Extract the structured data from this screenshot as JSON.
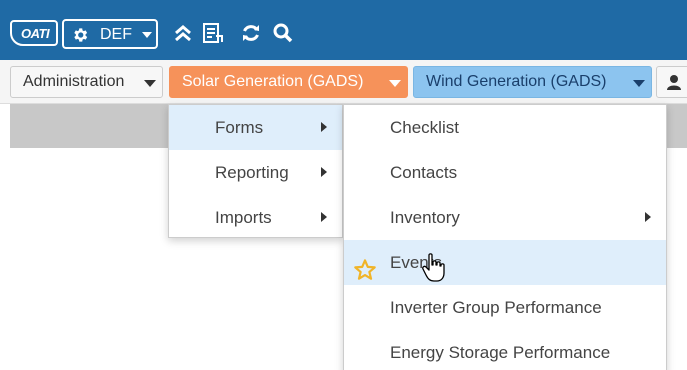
{
  "header": {
    "logo_text": "OATI",
    "environment": {
      "label": "DEF",
      "icon": "gear-icon"
    },
    "tools": [
      {
        "name": "collapse-icon"
      },
      {
        "name": "checklist-icon"
      },
      {
        "name": "refresh-icon"
      },
      {
        "name": "search-icon"
      }
    ],
    "background_color": "#1f6aa5"
  },
  "nav": {
    "administration": "Administration",
    "solar": "Solar Generation (GADS)",
    "wind": "Wind Generation (GADS)",
    "user_icon": "user-icon",
    "colors": {
      "solar": "#f6925a",
      "wind": "#8cc4ef"
    }
  },
  "menu_level1": {
    "items": [
      {
        "label": "Forms",
        "has_submenu": true,
        "active": true
      },
      {
        "label": "Reporting",
        "has_submenu": true,
        "active": false
      },
      {
        "label": "Imports",
        "has_submenu": true,
        "active": false
      }
    ]
  },
  "menu_level2": {
    "items": [
      {
        "label": "Checklist"
      },
      {
        "label": "Contacts"
      },
      {
        "label": "Inventory",
        "has_submenu": true
      },
      {
        "label": "Events",
        "favorite": true,
        "hovered": true
      },
      {
        "label": "Inverter Group Performance"
      },
      {
        "label": "Energy Storage Performance"
      }
    ],
    "favorite_color": "#f0b429",
    "hover_color": "#dfeefb"
  }
}
